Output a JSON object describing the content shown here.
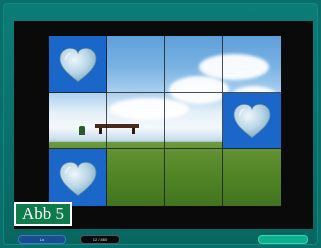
{
  "figure_label": "Abb 5",
  "controls": {
    "left_button": "Lo",
    "counter": "12 / 860",
    "right_button": ""
  },
  "board": {
    "rows": 3,
    "cols": 4,
    "cards": [
      {
        "row": 0,
        "col": 0,
        "face_up": true,
        "symbol": "heart-stone"
      },
      {
        "row": 0,
        "col": 1,
        "face_up": false
      },
      {
        "row": 0,
        "col": 2,
        "face_up": false
      },
      {
        "row": 0,
        "col": 3,
        "face_up": false
      },
      {
        "row": 1,
        "col": 0,
        "face_up": false
      },
      {
        "row": 1,
        "col": 1,
        "face_up": false
      },
      {
        "row": 1,
        "col": 2,
        "face_up": false
      },
      {
        "row": 1,
        "col": 3,
        "face_up": true,
        "symbol": "heart-stone"
      },
      {
        "row": 2,
        "col": 0,
        "face_up": true,
        "symbol": "heart-stone"
      },
      {
        "row": 2,
        "col": 1,
        "face_up": false
      },
      {
        "row": 2,
        "col": 2,
        "face_up": false
      },
      {
        "row": 2,
        "col": 3,
        "face_up": false
      }
    ]
  },
  "colors": {
    "frame": "#0a6f6a",
    "card_face": "#1a66c9",
    "label_bg": "#0d7c4a"
  }
}
